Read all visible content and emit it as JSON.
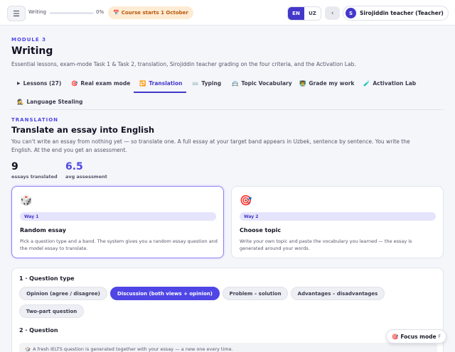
{
  "topbar": {
    "menu_icon": "☰",
    "progress_label": "Writing",
    "progress_fraction": 0,
    "progress_percent": "0%",
    "course_icon": "📅",
    "course_text": "Course starts 1 October",
    "lang_en": "EN",
    "lang_uz": "UZ",
    "back_icon": "‹",
    "avatar_initial": "S",
    "user_name": "Sirojiddin teacher (Teacher)"
  },
  "header": {
    "module_label": "MODULE 3",
    "title": "Writing",
    "subtitle": "Essential lessons, exam-mode Task 1 & Task 2, translation, Sirojiddin teacher grading on the four criteria, and the Activation Lab."
  },
  "tabs": [
    {
      "icon": "▶",
      "label": "Lessons (27)"
    },
    {
      "icon": "🎯",
      "label": "Real exam mode"
    },
    {
      "icon": "🔁",
      "label": "Translation"
    },
    {
      "icon": "⌨️",
      "label": "Typing"
    },
    {
      "icon": "📇",
      "label": "Topic Vocabulary"
    },
    {
      "icon": "👨‍🏫",
      "label": "Grade my work"
    },
    {
      "icon": "🧪",
      "label": "Activation Lab"
    },
    {
      "icon": "🕵️",
      "label": "Language Stealing"
    }
  ],
  "translation": {
    "eyebrow": "TRANSLATION",
    "title": "Translate an essay into English",
    "description": "You can't write an essay from nothing yet — so translate one. A full essay at your target band appears in Uzbek, sentence by sentence. You write the English. At the end you get an assessment.",
    "stats": [
      {
        "value": "9",
        "label": "essays translated"
      },
      {
        "value": "6.5",
        "label": "avg assessment"
      }
    ]
  },
  "cards": [
    {
      "icon": "🎲",
      "way": "Way 1",
      "title": "Random essay",
      "description": "Pick a question type and a band. The system gives you a random essay question and the model essay to translate."
    },
    {
      "icon": "🎯",
      "way": "Way 2",
      "title": "Choose topic",
      "description": "Write your own topic and paste the vocabulary you learned — the essay is generated around your words."
    }
  ],
  "form": {
    "question_type_title": "1 · Question type",
    "question_types": [
      "Opinion (agree / disagree)",
      "Discussion (both views + opinion)",
      "Problem – solution",
      "Advantages – disadvantages",
      "Two-part question"
    ],
    "question_title": "2 · Question",
    "question_hint_icon": "🎲",
    "question_hint": "A fresh IELTS question is generated together with your essay — a new one every time."
  },
  "focus_mode": {
    "icon": "🎯",
    "label": "Focus mode",
    "shortcut": "F"
  }
}
